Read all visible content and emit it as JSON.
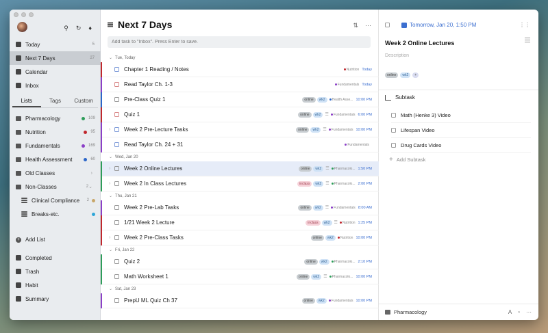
{
  "sidebar": {
    "nav": [
      {
        "label": "Today",
        "count": "5",
        "icon": "today-icon",
        "name": "today"
      },
      {
        "label": "Next 7 Days",
        "count": "27",
        "icon": "next7days-icon",
        "name": "next-7-days",
        "active": true
      },
      {
        "label": "Calendar",
        "count": "",
        "icon": "calendar-icon",
        "name": "calendar"
      },
      {
        "label": "Inbox",
        "count": "",
        "icon": "inbox-icon",
        "name": "inbox"
      }
    ],
    "tabs": [
      "Lists",
      "Tags",
      "Custom"
    ],
    "lists": [
      {
        "label": "Pharmacology",
        "count": "109",
        "color": "#2e9d5a"
      },
      {
        "label": "Nutrition",
        "count": "95",
        "color": "#c0272d"
      },
      {
        "label": "Fundamentals",
        "count": "169",
        "color": "#8b3fc7"
      },
      {
        "label": "Health Assessment",
        "count": "60",
        "color": "#2b66c9"
      }
    ],
    "folders": [
      {
        "label": "Old Classes",
        "count": "",
        "expanded": false
      },
      {
        "label": "Non-Classes",
        "count": "2",
        "expanded": true
      }
    ],
    "sublists": [
      {
        "label": "Clinical Compliance",
        "count": "2",
        "color": "#c8a76a"
      },
      {
        "label": "Breaks-etc.",
        "count": "",
        "color": "#2fa6d8"
      }
    ],
    "add_list": "Add List",
    "bottom": [
      {
        "label": "Completed",
        "icon": "completed-icon"
      },
      {
        "label": "Trash",
        "icon": "trash-icon"
      },
      {
        "label": "Habit",
        "icon": "habit-icon"
      },
      {
        "label": "Summary",
        "icon": "summary-icon"
      }
    ]
  },
  "main": {
    "title": "Next 7 Days",
    "add_placeholder": "Add task to \"Inbox\". Press Enter to save.",
    "sections": [
      {
        "header": "Tue, Today",
        "tasks": [
          {
            "title": "Chapter 1 Reading / Notes",
            "tags": [],
            "list": "Nutrition",
            "list_color": "#c0272d",
            "due": "Today",
            "bar": "#c0272d",
            "expand": false,
            "subtask_icon": false
          },
          {
            "title": "Read Taylor Ch. 1-3",
            "tags": [],
            "list": "Fundamentals",
            "list_color": "#8b3fc7",
            "due": "Today",
            "bar": "#8b3fc7",
            "expand": false,
            "subtask_icon": false
          },
          {
            "title": "Pre-Class Quiz 1",
            "tags": [
              "online",
              "wk2"
            ],
            "list": "Health Asse...",
            "list_color": "#2b66c9",
            "due": "10:00 PM",
            "bar": "#2b66c9",
            "expand": false,
            "subtask_icon": false
          },
          {
            "title": "Quiz 1",
            "tags": [
              "online",
              "wk2"
            ],
            "list": "Fundamentals",
            "list_color": "#8b3fc7",
            "due": "6:00 PM",
            "bar": "#c0272d",
            "expand": false,
            "subtask_icon": true
          },
          {
            "title": "Week 2 Pre-Lecture Tasks",
            "tags": [
              "online",
              "wk2"
            ],
            "list": "Fundamentals",
            "list_color": "#8b3fc7",
            "due": "10:00 PM",
            "bar": "#8b3fc7",
            "expand": true,
            "subtask_icon": true
          },
          {
            "title": "Read Taylor Ch. 24 + 31",
            "tags": [],
            "list": "Fundamentals",
            "list_color": "#8b3fc7",
            "due": "",
            "bar": "#8b3fc7",
            "expand": false,
            "subtask_icon": false
          }
        ]
      },
      {
        "header": "Wed, Jan 20",
        "tasks": [
          {
            "title": "Week 2 Online Lectures",
            "tags": [
              "online",
              "wk2"
            ],
            "list": "Pharmacolo...",
            "list_color": "#2e9d5a",
            "due": "1:50 PM",
            "bar": "#2e9d5a",
            "expand": true,
            "subtask_icon": true,
            "selected": true
          },
          {
            "title": "Week 2 In Class Lectures",
            "tags": [
              "inclass",
              "wk2"
            ],
            "list": "Pharmacolo...",
            "list_color": "#2e9d5a",
            "due": "2:00 PM",
            "bar": "#2e9d5a",
            "expand": true,
            "subtask_icon": true
          }
        ]
      },
      {
        "header": "Thu, Jan 21",
        "tasks": [
          {
            "title": "Week 2 Pre-Lab Tasks",
            "tags": [
              "online",
              "wk2"
            ],
            "list": "Fundamentals",
            "list_color": "#8b3fc7",
            "due": "8:00 AM",
            "bar": "#8b3fc7",
            "expand": false,
            "subtask_icon": true
          },
          {
            "title": "1/21 Week 2 Lecture",
            "tags": [
              "inclass",
              "wk2"
            ],
            "list": "Nutrition",
            "list_color": "#c0272d",
            "due": "1:25 PM",
            "bar": "#c0272d",
            "expand": false,
            "subtask_icon": true
          },
          {
            "title": "Week 2 Pre-Class Tasks",
            "tags": [
              "online",
              "wk2"
            ],
            "list": "Nutrition",
            "list_color": "#c0272d",
            "due": "10:00 PM",
            "bar": "#c0272d",
            "expand": true,
            "subtask_icon": false
          }
        ]
      },
      {
        "header": "Fri, Jan 22",
        "tasks": [
          {
            "title": "Quiz 2",
            "tags": [
              "online",
              "wk2"
            ],
            "list": "Pharmacolo...",
            "list_color": "#2e9d5a",
            "due": "2:10 PM",
            "bar": "#2e9d5a",
            "expand": false,
            "subtask_icon": false
          },
          {
            "title": "Math Worksheet 1",
            "tags": [
              "online",
              "wk2"
            ],
            "list": "Pharmacolo...",
            "list_color": "#2e9d5a",
            "due": "10:00 PM",
            "bar": "#2e9d5a",
            "expand": false,
            "subtask_icon": true
          }
        ]
      },
      {
        "header": "Sat, Jan 23",
        "tasks": [
          {
            "title": "PrepU ML Quiz Ch 37",
            "tags": [
              "online",
              "wk2"
            ],
            "list": "Fundamentals",
            "list_color": "#8b3fc7",
            "due": "10:00 PM",
            "bar": "#8b3fc7",
            "expand": false,
            "subtask_icon": false
          }
        ]
      }
    ]
  },
  "detail": {
    "date": "Tomorrow, Jan 20, 1:50 PM",
    "title": "Week 2 Online Lectures",
    "description_placeholder": "Description",
    "tags": [
      "online",
      "wk2"
    ],
    "add_tag": "+",
    "subtask_header": "Subtask",
    "subtasks": [
      "Math (Henke 3) Video",
      "Lifespan Video",
      "Drug Cards Video"
    ],
    "add_subtask": "Add Subtask",
    "list": "Pharmacology"
  }
}
